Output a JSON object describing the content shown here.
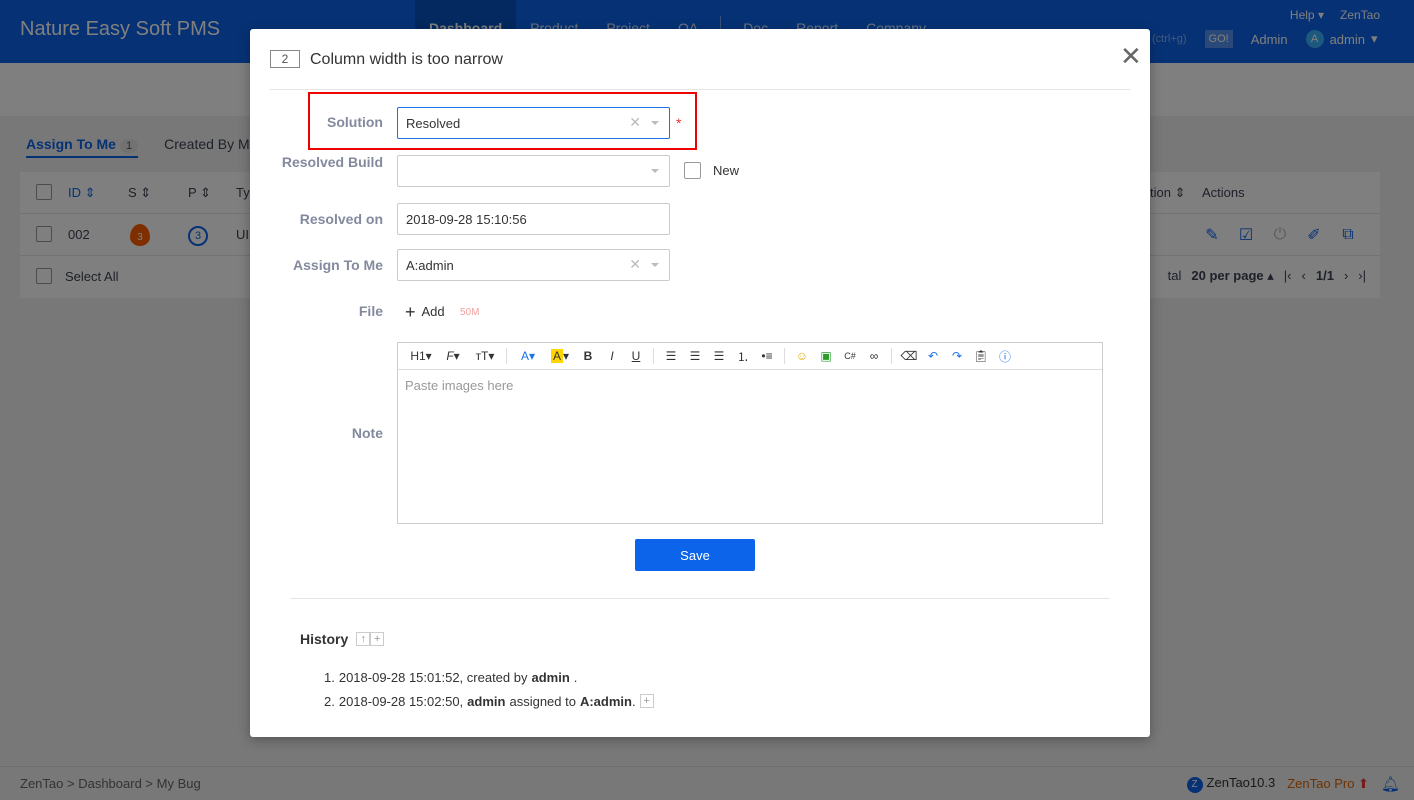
{
  "app": {
    "brand": "Nature Easy Soft PMS",
    "nav": [
      "Dashboard",
      "Product",
      "Project",
      "QA",
      "Doc",
      "Report",
      "Company"
    ],
    "help": "Help",
    "zentao": "ZenTao",
    "search_hint": "(ctrl+g)",
    "go": "GO!",
    "admin_link": "Admin",
    "user_initial": "A",
    "user_name": "admin"
  },
  "tabs": {
    "assign_to_me": "Assign To Me",
    "assign_count": "1",
    "created_by_me": "Created By Me"
  },
  "table": {
    "headers": [
      "ID",
      "S",
      "P",
      "Ty",
      "tion",
      "Actions"
    ],
    "row": {
      "id": "002",
      "severity": "3",
      "priority": "3",
      "type": "UI"
    },
    "select_all": "Select All",
    "pager_total": "tal",
    "per_page": "20 per page",
    "page": "1/1"
  },
  "modal": {
    "id": "2",
    "title": "Column width is too narrow",
    "solution_label": "Solution",
    "solution_value": "Resolved",
    "resolved_build_label": "Resolved Build",
    "new_label": "New",
    "resolved_on_label": "Resolved on",
    "resolved_on_value": "2018-09-28 15:10:56",
    "assign_label": "Assign To Me",
    "assign_value": "A:admin",
    "file_label": "File",
    "add_label": "Add",
    "file_limit": "50M",
    "note_label": "Note",
    "editor_placeholder": "Paste images here",
    "save_label": "Save",
    "history_label": "History",
    "history": [
      {
        "num": "1.",
        "time": "2018-09-28 15:01:52, created by",
        "user": "admin",
        "tail": "."
      },
      {
        "num": "2.",
        "time": "2018-09-28 15:02:50,",
        "user": "admin",
        "action": "assigned to",
        "target": "A:admin",
        "tail": "."
      }
    ]
  },
  "footer": {
    "breadcrumb": [
      "ZenTao",
      "Dashboard",
      "My Bug"
    ],
    "version": "ZenTao10.3",
    "pro": "ZenTao Pro"
  },
  "colors": {
    "primary": "#0c64eb",
    "highlight": "#ee0000",
    "required": "#e53333"
  }
}
